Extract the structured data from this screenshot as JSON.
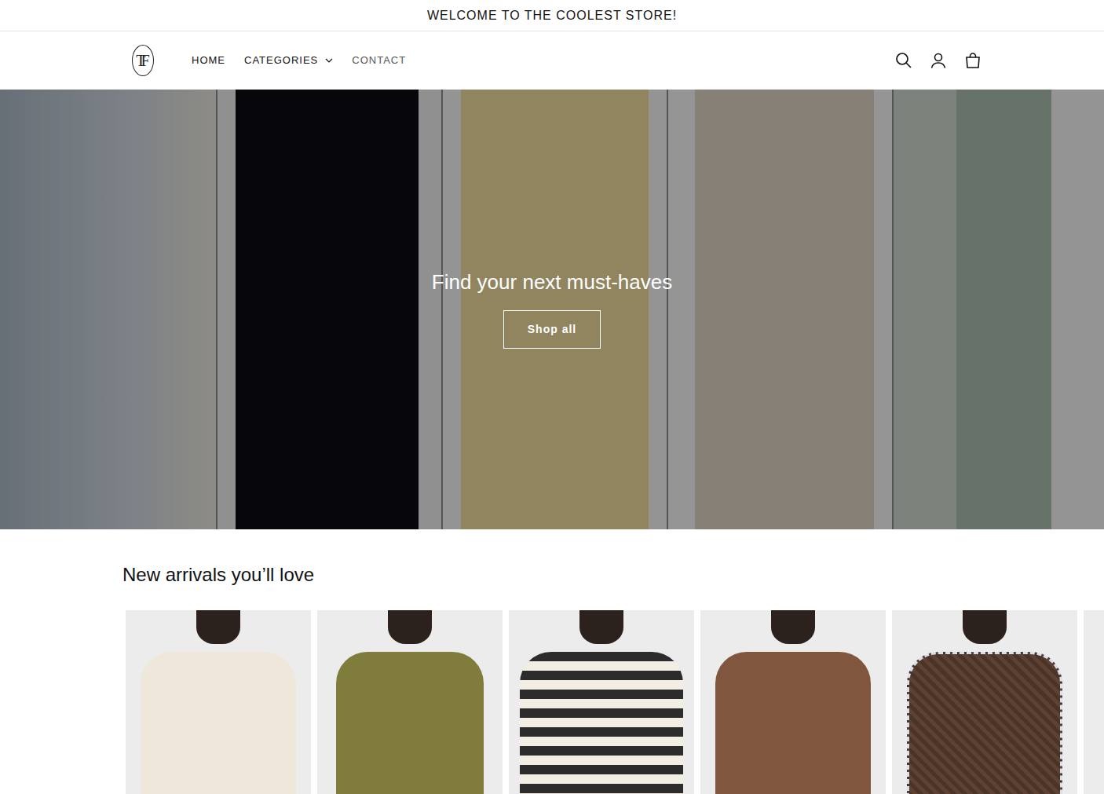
{
  "announcement": "WELCOME TO THE COOLEST STORE!",
  "logo": {
    "text": "TF"
  },
  "nav": [
    {
      "label": "HOME",
      "kind": "link"
    },
    {
      "label": "CATEGORIES",
      "kind": "dropdown",
      "expanded": false
    },
    {
      "label": "CONTACT",
      "kind": "link"
    }
  ],
  "hero": {
    "title": "Find your next must-haves",
    "button": "Shop all"
  },
  "new_arrivals": {
    "title": "New arrivals you’ll love"
  }
}
